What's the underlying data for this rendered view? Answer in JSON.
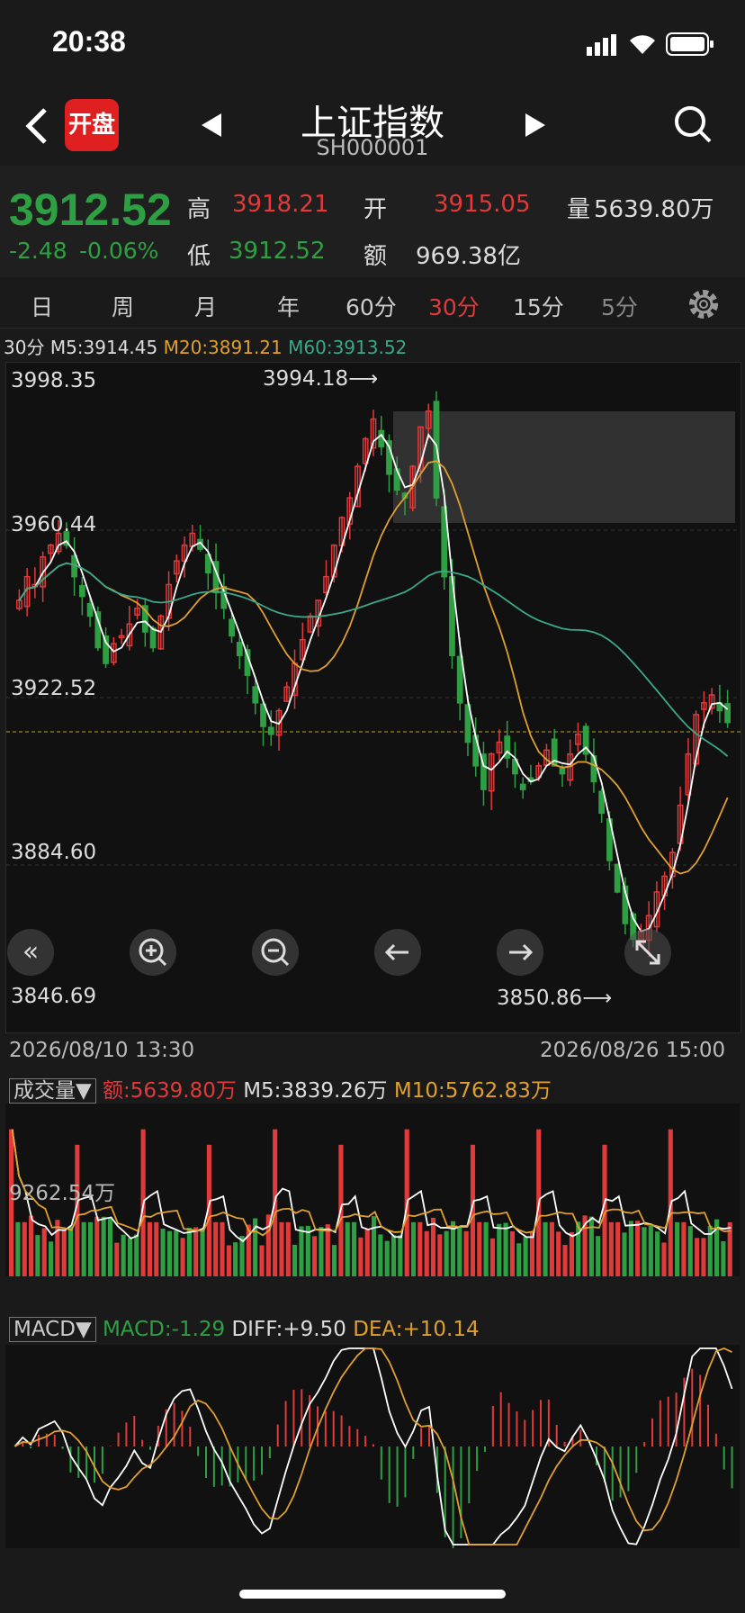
{
  "status": {
    "time": "20:38"
  },
  "header": {
    "title": "上证指数",
    "subtitle": "SH000001",
    "open_badge": "开盘"
  },
  "quote": {
    "price": "3912.52",
    "change": "-2.48",
    "change_pct": "-0.06%",
    "high_label": "高",
    "high": "3918.21",
    "low_label": "低",
    "low": "3912.52",
    "open_label": "开",
    "open": "3915.05",
    "amount_label": "额",
    "amount": "969.38亿",
    "volume_label": "量",
    "volume": "5639.80万"
  },
  "tabs": [
    {
      "label": "日",
      "active": false
    },
    {
      "label": "周",
      "active": false
    },
    {
      "label": "月",
      "active": false
    },
    {
      "label": "年",
      "active": false
    },
    {
      "label": "60分",
      "active": false
    },
    {
      "label": "30分",
      "active": true
    },
    {
      "label": "15分",
      "active": false
    },
    {
      "label": "5分",
      "active": false
    }
  ],
  "ma_legend": {
    "period": "30分",
    "m5": "M5:3914.45",
    "m20": "M20:3891.21",
    "m60": "M60:3913.52"
  },
  "main_chart": {
    "y_labels": [
      "3998.35",
      "3960.44",
      "3922.52",
      "3884.60",
      "3846.69"
    ],
    "high_marker": "3994.18⟶",
    "low_marker": "3850.86⟶",
    "date_start": "2026/08/10 13:30",
    "date_end": "2026/08/26 15:00"
  },
  "volume_legend": {
    "name": "成交量▼",
    "amount": "额:5639.80万",
    "m5": "M5:3839.26万",
    "m10": "M10:5762.83万",
    "axis": "9262.54万"
  },
  "macd_legend": {
    "name": "MACD▼",
    "macd": "MACD:-1.29",
    "diff": "DIFF:+9.50",
    "dea": "DEA:+10.14"
  },
  "colors": {
    "up": "#e03a3a",
    "down": "#2ea043",
    "m5": "#ffffff",
    "m20": "#e0a030",
    "m60": "#3aa88a"
  },
  "chart_data": {
    "type": "candlestick",
    "ylim": [
      3846.69,
      3998.35
    ],
    "close_path": [
      3944,
      3950,
      3948,
      3955,
      3958,
      3961,
      3958,
      3950,
      3945,
      3940,
      3932,
      3928,
      3933,
      3935,
      3938,
      3942,
      3936,
      3932,
      3940,
      3948,
      3954,
      3958,
      3961,
      3957,
      3951,
      3946,
      3942,
      3935,
      3930,
      3925,
      3918,
      3912,
      3910,
      3916,
      3922,
      3928,
      3934,
      3940,
      3944,
      3950,
      3958,
      3965,
      3970,
      3978,
      3985,
      3990,
      3983,
      3976,
      3972,
      3970,
      3978,
      3988,
      3992,
      3970,
      3950,
      3930,
      3918,
      3908,
      3902,
      3896,
      3905,
      3908,
      3904,
      3900,
      3896,
      3898,
      3902,
      3906,
      3902,
      3900,
      3905,
      3910,
      3905,
      3898,
      3890,
      3878,
      3870,
      3862,
      3858,
      3860,
      3864,
      3870,
      3874,
      3880,
      3892,
      3905,
      3915,
      3918,
      3920,
      3916,
      3913
    ],
    "volume_pattern": [
      9262.54,
      5639.8
    ]
  }
}
